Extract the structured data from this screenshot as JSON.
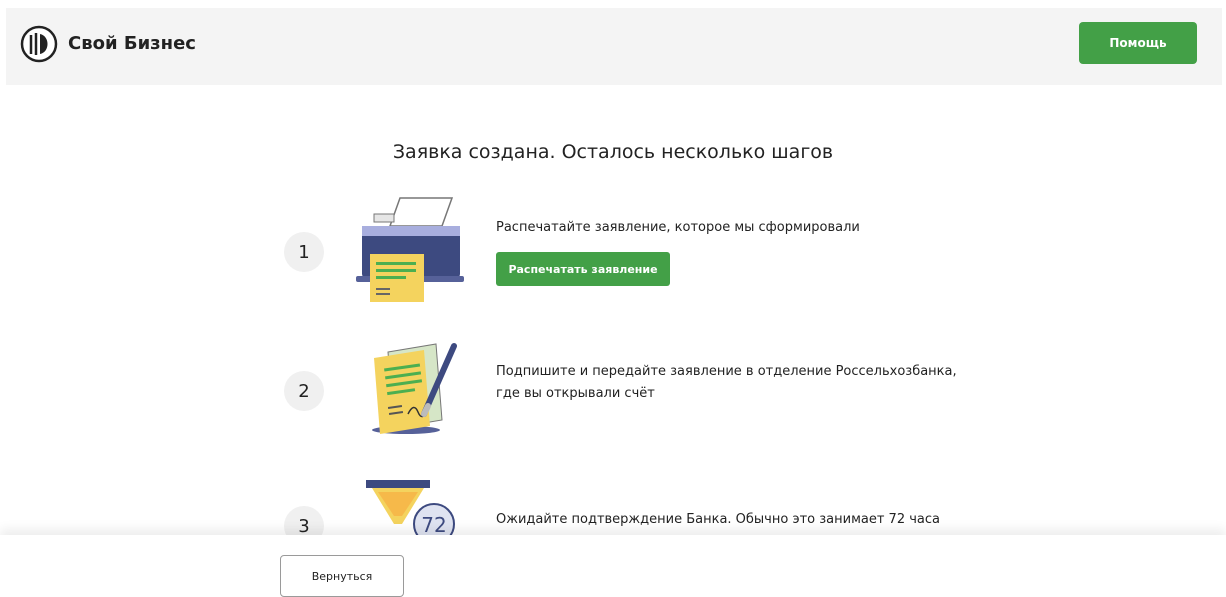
{
  "header": {
    "brand": "Свой Бизнес",
    "help_label": "Помощь",
    "logo_icon": "bank-logo-icon"
  },
  "main": {
    "title": "Заявка создана. Осталось несколько шагов",
    "steps": [
      {
        "number": "1",
        "text": "Распечатайте заявление, которое мы сформировали",
        "button_label": "Распечатать заявление",
        "icon": "printer-icon"
      },
      {
        "number": "2",
        "text_line1": "Подпишите и передайте заявление в отделение Россельхозбанка,",
        "text_line2": "где вы открывали счёт",
        "icon": "signed-document-icon"
      },
      {
        "number": "3",
        "text": "Ожидайте подтверждение Банка. Обычно это занимает 72 часа",
        "icon": "hourglass-icon",
        "badge": "72"
      }
    ]
  },
  "footer": {
    "back_label": "Вернуться"
  },
  "colors": {
    "accent": "#43a047",
    "header_bg": "#f4f4f4",
    "step_circle": "#f0f0f0"
  }
}
